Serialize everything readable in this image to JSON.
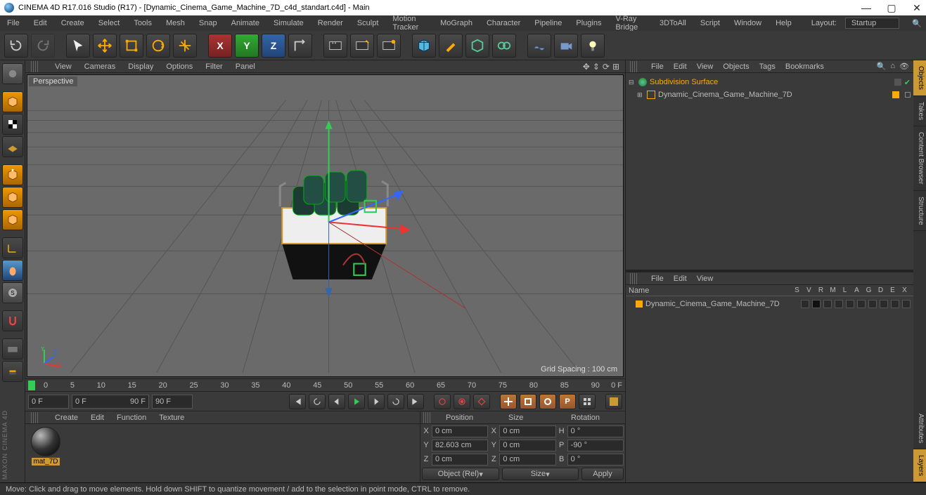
{
  "title": "CINEMA 4D R17.016 Studio (R17) - [Dynamic_Cinema_Game_Machine_7D_c4d_standart.c4d] - Main",
  "menubar": [
    "File",
    "Edit",
    "Create",
    "Select",
    "Tools",
    "Mesh",
    "Snap",
    "Animate",
    "Simulate",
    "Render",
    "Sculpt",
    "Motion Tracker",
    "MoGraph",
    "Character",
    "Pipeline",
    "Plugins",
    "V-Ray Bridge",
    "3DToAll",
    "Script",
    "Window",
    "Help"
  ],
  "layout_label": "Layout:",
  "layout_value": "Startup",
  "axes": {
    "x": "X",
    "y": "Y",
    "z": "Z"
  },
  "viewport_menu": [
    "View",
    "Cameras",
    "Display",
    "Options",
    "Filter",
    "Panel"
  ],
  "perspective_label": "Perspective",
  "grid_spacing": "Grid Spacing : 100 cm",
  "timeline_ticks": [
    "0",
    "5",
    "10",
    "15",
    "20",
    "25",
    "30",
    "35",
    "40",
    "45",
    "50",
    "55",
    "60",
    "65",
    "70",
    "75",
    "80",
    "85",
    "90"
  ],
  "timeline_end": "0 F",
  "playbar": {
    "start": "0 F",
    "range_a": "0 F",
    "range_b": "90 F",
    "current": "90 F"
  },
  "mat_menu": [
    "Create",
    "Edit",
    "Function",
    "Texture"
  ],
  "material_name": "mat_7D",
  "coord": {
    "headers": [
      "Position",
      "Size",
      "Rotation"
    ],
    "rows": [
      {
        "a": "X",
        "p": "0 cm",
        "sa": "X",
        "s": "0 cm",
        "ra": "H",
        "r": "0 °"
      },
      {
        "a": "Y",
        "p": "82.603 cm",
        "sa": "Y",
        "s": "0 cm",
        "ra": "P",
        "r": "-90 °"
      },
      {
        "a": "Z",
        "p": "0 cm",
        "sa": "Z",
        "s": "0 cm",
        "ra": "B",
        "r": "0 °"
      }
    ],
    "mode1": "Object (Rel)",
    "mode2": "Size",
    "apply": "Apply"
  },
  "om_menu": [
    "File",
    "Edit",
    "View",
    "Objects",
    "Tags",
    "Bookmarks"
  ],
  "om_items": [
    {
      "name": "Subdivision Surface",
      "sel": true,
      "icon": "subd"
    },
    {
      "name": "Dynamic_Cinema_Game_Machine_7D",
      "sel": false,
      "icon": "null",
      "child": true
    }
  ],
  "tm_menu": [
    "File",
    "Edit",
    "View"
  ],
  "tm_header_name": "Name",
  "tm_cols": [
    "S",
    "V",
    "R",
    "M",
    "L",
    "A",
    "G",
    "D",
    "E",
    "X"
  ],
  "tm_item": "Dynamic_Cinema_Game_Machine_7D",
  "right_tabs": [
    "Objects",
    "Takes",
    "Content Browser",
    "Structure"
  ],
  "right_tabs2": [
    "Attributes",
    "Layers"
  ],
  "statusbar": "Move: Click and drag to move elements. Hold down SHIFT to quantize movement / add to the selection in point mode, CTRL to remove.",
  "brand": "MAXON CINEMA 4D"
}
